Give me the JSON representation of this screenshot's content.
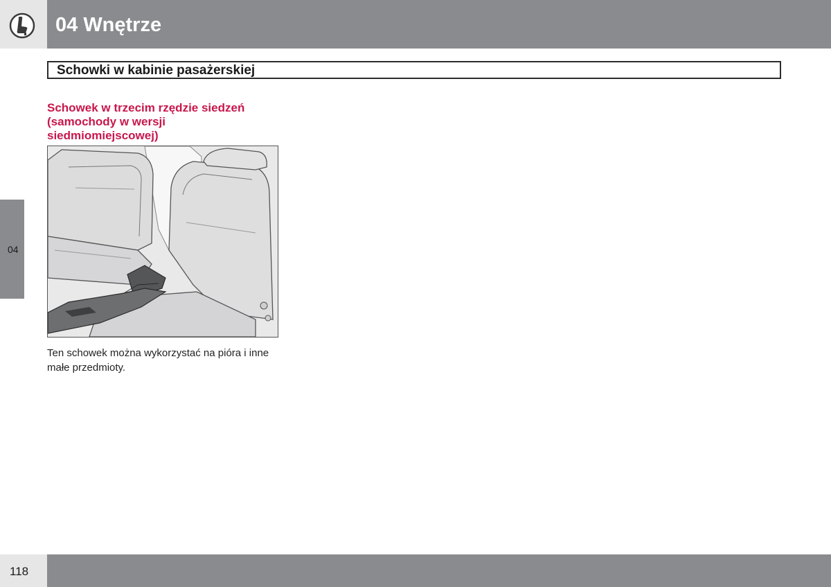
{
  "header": {
    "chapter_title": "04 Wnętrze",
    "icon": "seat-icon"
  },
  "section": {
    "title": "Schowki w kabinie pasażerskiej"
  },
  "side_tab": {
    "label": "04"
  },
  "content": {
    "subheading": "Schowek w trzecim rzędzie siedzeń (samochody w wersji siedmiomiejscowej)",
    "illustration": "seat-storage-illustration",
    "body": "Ten schowek można wykorzystać na pióra i inne małe przedmioty."
  },
  "footer": {
    "page_number": "118"
  },
  "colors": {
    "header_band": "#8a8b8e",
    "header_corner": "#e6e6e7",
    "subheading": "#c8174b"
  }
}
